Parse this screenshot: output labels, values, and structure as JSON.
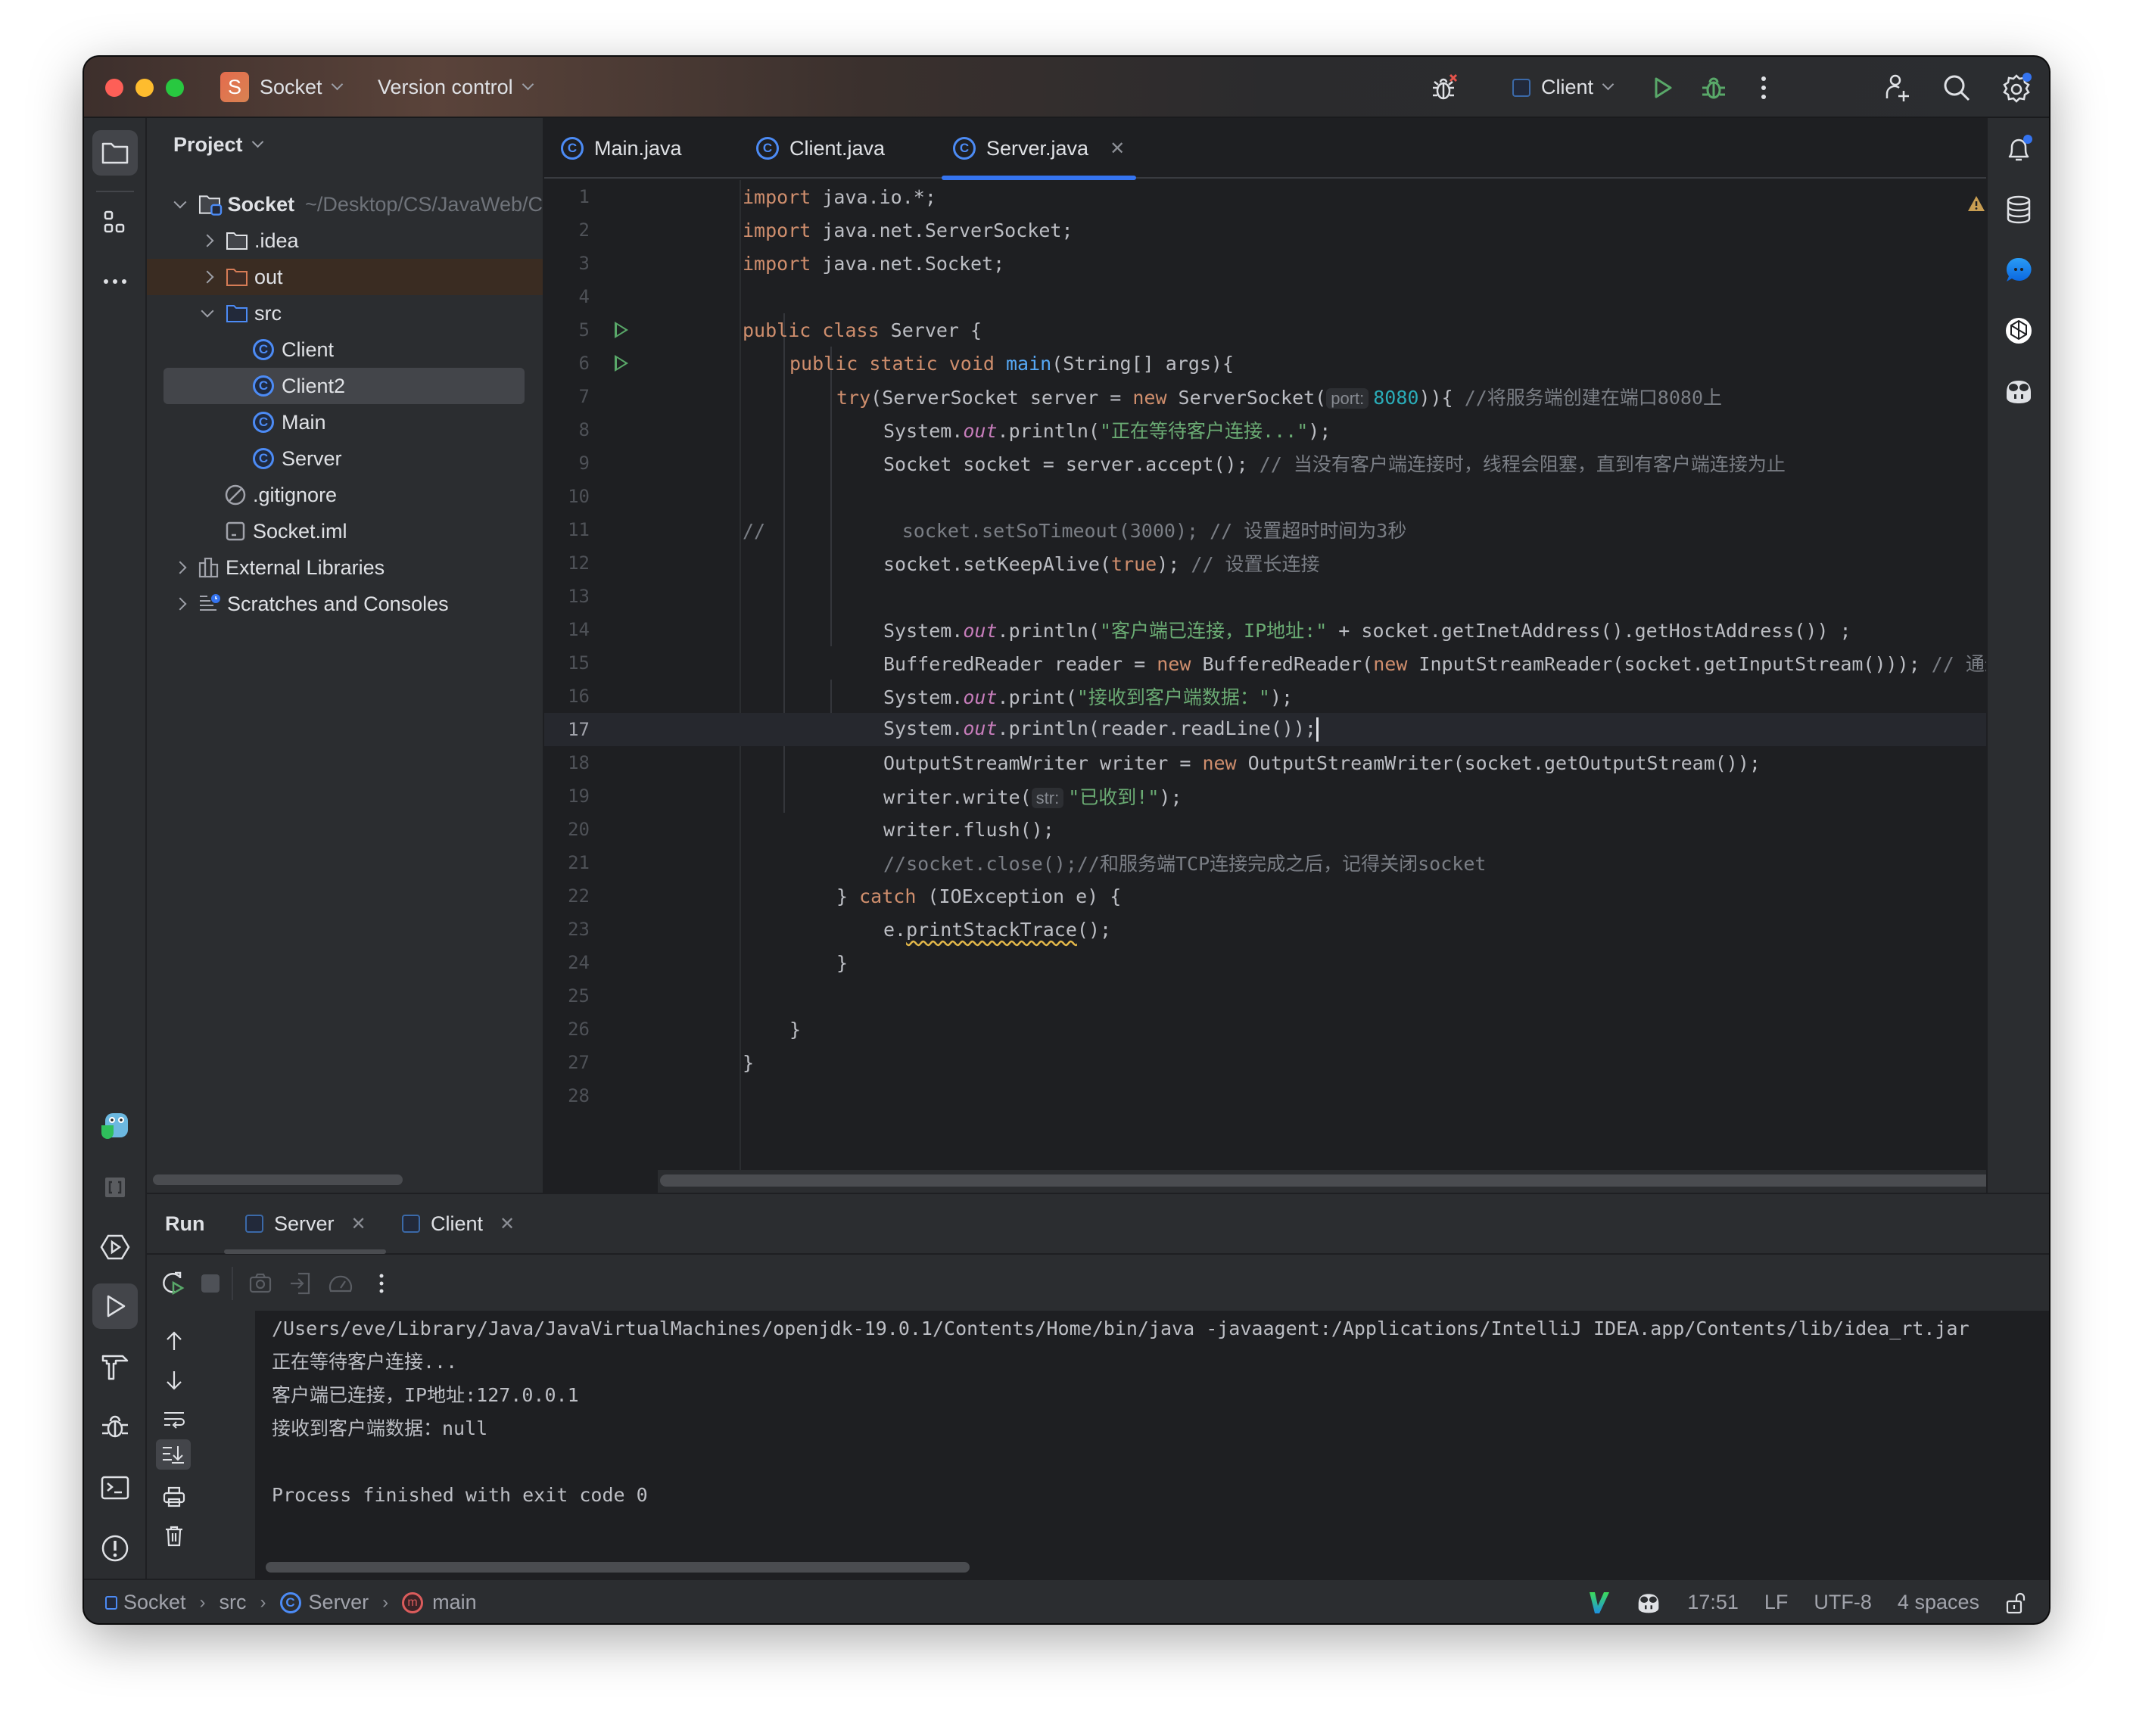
{
  "titlebar": {
    "project_initial": "S",
    "project_name": "Socket",
    "vcs_label": "Version control",
    "run_config": "Client"
  },
  "project_panel": {
    "title": "Project",
    "tree": [
      {
        "label": "Socket",
        "path_hint": "~/Desktop/CS/JavaWeb/C",
        "icon": "module-folder-icon",
        "expanded": true
      },
      {
        "label": ".idea",
        "icon": "folder-icon",
        "expanded": false
      },
      {
        "label": "out",
        "icon": "excluded-folder-icon",
        "expanded": false
      },
      {
        "label": "src",
        "icon": "source-folder-icon",
        "expanded": true
      },
      {
        "label": "Client",
        "icon": "java-class-icon"
      },
      {
        "label": "Client2",
        "icon": "java-class-icon",
        "selected": true
      },
      {
        "label": "Main",
        "icon": "java-class-icon"
      },
      {
        "label": "Server",
        "icon": "java-class-icon"
      },
      {
        "label": ".gitignore",
        "icon": "ignore-file-icon"
      },
      {
        "label": "Socket.iml",
        "icon": "module-file-icon"
      },
      {
        "label": "External Libraries",
        "icon": "libraries-icon",
        "expanded": false
      },
      {
        "label": "Scratches and Consoles",
        "icon": "scratches-icon",
        "expanded": false
      }
    ]
  },
  "editor": {
    "tabs": [
      {
        "label": "Main.java",
        "active": false
      },
      {
        "label": "Client.java",
        "active": false
      },
      {
        "label": "Server.java",
        "active": true
      }
    ],
    "warnings_count": "1",
    "current_line": 17,
    "lines": [
      {
        "n": "1"
      },
      {
        "n": "2"
      },
      {
        "n": "3"
      },
      {
        "n": "4"
      },
      {
        "n": "5"
      },
      {
        "n": "6"
      },
      {
        "n": "7"
      },
      {
        "n": "8"
      },
      {
        "n": "9"
      },
      {
        "n": "10"
      },
      {
        "n": "11"
      },
      {
        "n": "12"
      },
      {
        "n": "13"
      },
      {
        "n": "14"
      },
      {
        "n": "15"
      },
      {
        "n": "16"
      },
      {
        "n": "17"
      },
      {
        "n": "18"
      },
      {
        "n": "19"
      },
      {
        "n": "20"
      },
      {
        "n": "21"
      },
      {
        "n": "22"
      },
      {
        "n": "23"
      },
      {
        "n": "24"
      },
      {
        "n": "25"
      },
      {
        "n": "26"
      },
      {
        "n": "27"
      },
      {
        "n": "28"
      }
    ],
    "code": {
      "l1": [
        "import",
        " java.io.*;"
      ],
      "l2": [
        "import",
        " java.net.ServerSocket;"
      ],
      "l3": [
        "import",
        " java.net.Socket;"
      ],
      "l5": [
        "public class",
        " Server {"
      ],
      "l6": [
        "public static void",
        "main",
        "(String[] args){"
      ],
      "l7": [
        "try",
        "(ServerSocket server = ",
        "new",
        " ServerSocket(",
        "port:",
        "8080",
        ")){ ",
        "//将服务端创建在端口8080上"
      ],
      "l8": [
        "System.",
        "out",
        ".println(",
        "\"正在等待客户连接...\"",
        ");"
      ],
      "l9": [
        "Socket socket = server.accept(); ",
        "// 当没有客户端连接时，线程会阻塞，直到有客户端连接为止"
      ],
      "l11": [
        "//",
        "            socket.setSoTimeout(3000); // 设置超时时间为3秒"
      ],
      "l12": [
        "socket.setKeepAlive(",
        "true",
        "); ",
        "// 设置长连接"
      ],
      "l14": [
        "System.",
        "out",
        ".println(",
        "\"客户端已连接，IP地址:\"",
        " + socket.getInetAddress().getHostAddress()) ;"
      ],
      "l15": [
        "BufferedReader reader = ",
        "new",
        " BufferedReader(",
        "new",
        " InputStreamReader(socket.getInputStream())); ",
        "// 通过"
      ],
      "l16": [
        "System.",
        "out",
        ".print(",
        "\"接收到客户端数据：\"",
        ");"
      ],
      "l17": [
        "System.",
        "out",
        ".println(reader.readLine());"
      ],
      "l18": [
        "OutputStreamWriter writer = ",
        "new",
        " OutputStreamWriter(socket.getOutputStream());"
      ],
      "l19": [
        "writer.write(",
        "str:",
        "\"已收到!\"",
        ");"
      ],
      "l20": [
        "writer.flush();"
      ],
      "l21": [
        "//socket.close();//和服务端TCP连接完成之后，记得关闭socket"
      ],
      "l22": [
        "} ",
        "catch",
        " (IOException e) {"
      ],
      "l23": [
        "e.",
        "printStackTrace",
        "();"
      ],
      "l24": [
        "}"
      ],
      "l26": [
        "}"
      ],
      "l27": [
        "}"
      ]
    }
  },
  "run_panel": {
    "title": "Run",
    "tabs": [
      {
        "label": "Server",
        "active": true
      },
      {
        "label": "Client",
        "active": false
      }
    ],
    "output": [
      "/Users/eve/Library/Java/JavaVirtualMachines/openjdk-19.0.1/Contents/Home/bin/java -javaagent:/Applications/IntelliJ IDEA.app/Contents/lib/idea_rt.jar",
      "正在等待客户连接...",
      "客户端已连接，IP地址:127.0.0.1",
      "接收到客户端数据：null",
      "",
      "Process finished with exit code 0"
    ]
  },
  "status_bar": {
    "breadcrumb": [
      "Socket",
      "src",
      "Server",
      "main"
    ],
    "cursor_position": "17:51",
    "line_separator": "LF",
    "encoding": "UTF-8",
    "indent": "4 spaces"
  },
  "colors": {
    "accent": "#3574f0",
    "keyword": "#cf8e6d",
    "string": "#6aab73",
    "comment": "#7a7e85",
    "method_decl": "#56a8f5",
    "static_field": "#c77dbb",
    "number": "#2aacb8",
    "warning": "#e5b94a",
    "run_green": "#59a869"
  }
}
